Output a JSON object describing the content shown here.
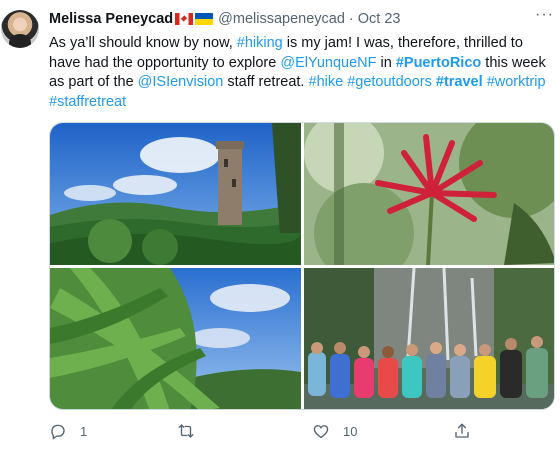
{
  "author": {
    "name": "Melissa Peneycad",
    "handle": "@melissapeneycad",
    "separator": "·",
    "date": "Oct 23",
    "flags": [
      "canada-flag",
      "ukraine-flag"
    ]
  },
  "tweet": {
    "segments": [
      {
        "text": "As ya’ll should know by now, ",
        "style": "plain"
      },
      {
        "text": "#hiking",
        "style": "link"
      },
      {
        "text": " is my jam! I was, therefore, thrilled to have had the opportunity to explore ",
        "style": "plain"
      },
      {
        "text": "@ElYunqueNF",
        "style": "link"
      },
      {
        "text": " in ",
        "style": "plain"
      },
      {
        "text": "#PuertoRico",
        "style": "bold-link"
      },
      {
        "text": " this week as part of the ",
        "style": "plain"
      },
      {
        "text": "@ISIenvision",
        "style": "link"
      },
      {
        "text": " staff retreat. ",
        "style": "plain"
      },
      {
        "text": "#hike",
        "style": "link"
      },
      {
        "text": " ",
        "style": "plain"
      },
      {
        "text": "#getoutdoors",
        "style": "link"
      },
      {
        "text": " ",
        "style": "plain"
      },
      {
        "text": "#travel",
        "style": "bold-link"
      },
      {
        "text": " ",
        "style": "plain"
      },
      {
        "text": "#worktrip",
        "style": "link"
      },
      {
        "text": " ",
        "style": "plain"
      },
      {
        "text": "#staffretreat",
        "style": "link"
      }
    ]
  },
  "media": {
    "photos": [
      {
        "name": "photo-tower-rainforest"
      },
      {
        "name": "photo-red-flower"
      },
      {
        "name": "photo-palm-leaves"
      },
      {
        "name": "photo-group-waterfall"
      }
    ]
  },
  "actions": {
    "reply_count": "1",
    "retweet_count": "",
    "like_count": "10",
    "icons": [
      "reply-icon",
      "retweet-icon",
      "like-icon",
      "share-icon"
    ]
  },
  "colors": {
    "link": "#1d9bf0",
    "text": "#0f1419",
    "muted": "#536471",
    "border": "#cfd9de"
  }
}
